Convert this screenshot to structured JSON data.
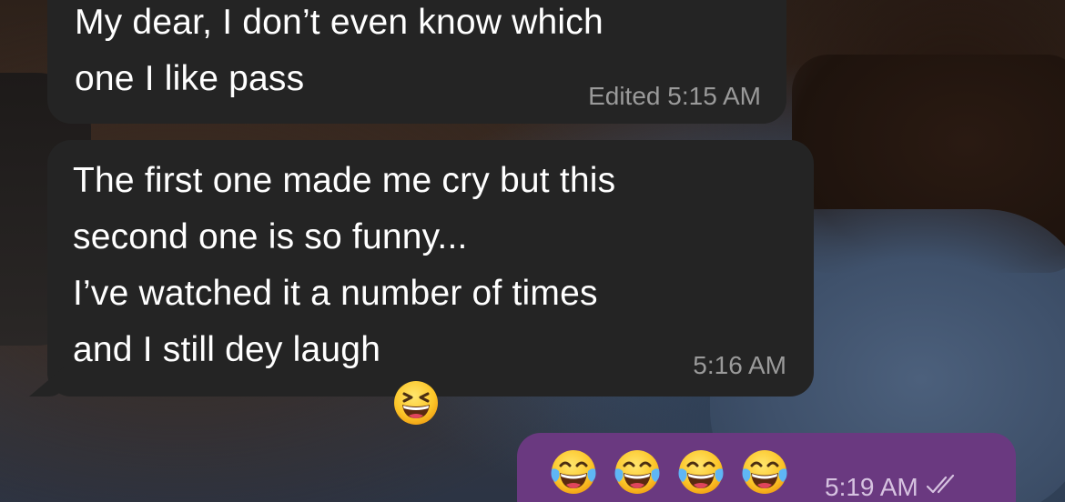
{
  "chat": {
    "messages": [
      {
        "direction": "incoming",
        "text": "My dear, I don’t even know which\none I like pass",
        "status": "Edited",
        "time": "5:15 AM"
      },
      {
        "direction": "incoming",
        "text": "The first one made me cry but this\nsecond one is so funny...\nI’ve watched it a number of times\nand I still dey laugh",
        "emoji": "grinning-squinting-face-icon",
        "time": "5:16 AM"
      },
      {
        "direction": "outgoing",
        "emojis": [
          "face-with-tears-of-joy-icon",
          "face-with-tears-of-joy-icon",
          "face-with-tears-of-joy-icon",
          "face-with-tears-of-joy-icon"
        ],
        "time": "5:19 AM",
        "receipt": "read-double-check-icon"
      }
    ]
  },
  "colors": {
    "incoming_bubble": "#242424",
    "outgoing_bubble": "#6a3980",
    "text": "#ffffff",
    "meta_incoming": "#9a9a9a",
    "meta_outgoing": "#d6c2e0"
  }
}
